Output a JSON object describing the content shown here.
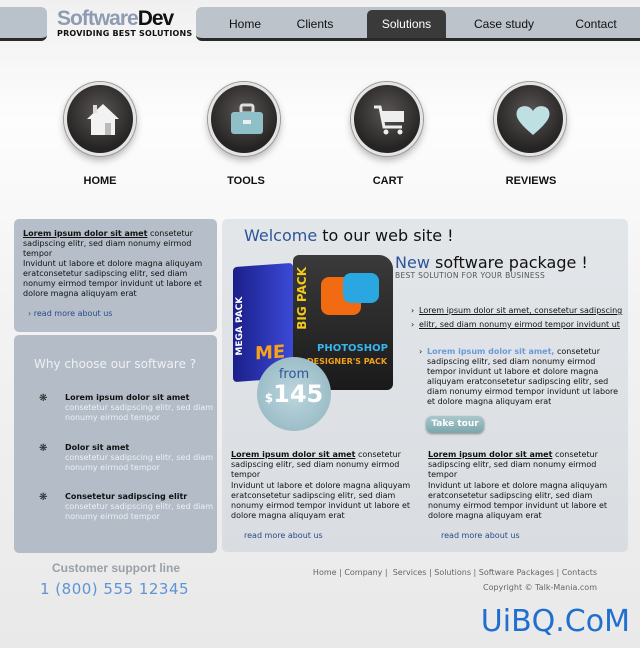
{
  "logo": {
    "brand_light": "Software",
    "brand_dark": "Dev",
    "tagline": "PROVIDING BEST SOLUTIONS"
  },
  "nav": [
    {
      "label": "Home"
    },
    {
      "label": "Clients"
    },
    {
      "label": "Solutions",
      "active": true
    },
    {
      "label": "Case study"
    },
    {
      "label": "Contact"
    }
  ],
  "icons": [
    {
      "label": "HOME",
      "icon": "house-icon"
    },
    {
      "label": "TOOLS",
      "icon": "toolbox-icon"
    },
    {
      "label": "CART",
      "icon": "cart-icon"
    },
    {
      "label": "REVIEWS",
      "icon": "heart-icon"
    }
  ],
  "about": {
    "bold": "Lorem ipsum dolor sit amet",
    "text1": " consetetur sadipscing elitr, sed diam nonumy eirmod tempor",
    "text2": "Invidunt ut labore et dolore magna aliquyam eratconsetetur sadipscing elitr, sed diam nonumy eirmod tempor invidunt ut labore et dolore magna aliquyam erat",
    "link": "read more about us"
  },
  "why": {
    "title": "Why choose our software ?",
    "items": [
      {
        "title": "Lorem ipsum dolor sit amet",
        "text": "consetetur sadipscing elitr, sed diam nonumy eirmod tempor"
      },
      {
        "title": "Dolor sit amet",
        "text": "consetetur sadipscing elitr, sed diam nonumy eirmod tempor"
      },
      {
        "title": "Consetetur sadipscing elitr",
        "text": "consetetur sadipscing elitr, sed diam nonumy eirmod tempor"
      }
    ]
  },
  "main": {
    "welcome_hl": "Welcome",
    "welcome_rest": " to our web site !",
    "new_hl": "New",
    "new_rest": " software package !",
    "subtitle": "BEST SOLUTION FOR YOUR BUSINESS",
    "price_from": "from",
    "price_currency": "$",
    "price": "145",
    "box_labels": {
      "mega": "MEGA PACK",
      "big": "BIG PACK",
      "ps": "PHOTOSHOP",
      "dp": "DESIGNER'S PACK"
    },
    "links": [
      "Lorem ipsum dolor sit amet, consetetur sadipscing",
      "elitr, sed diam nonumy eirmod tempor invidunt ut"
    ],
    "para_hl": "Lorem ipsum dolor sit amet,",
    "para_text": " consetetur sadipscing elitr, sed diam nonumy eirmod tempor invidunt ut labore et dolore magna aliquyam eratconsetetur sadipscing elitr, sed diam nonumy eirmod tempor invidunt ut labore et dolore magna aliquyam erat",
    "tour": "Take tour",
    "cols": [
      {
        "bold": "Lorem ipsum dolor sit amet",
        "text1": " consetetur sadipscing elitr, sed diam nonumy eirmod tempor",
        "text2": "Invidunt ut labore et dolore magna aliquyam eratconsetetur sadipscing elitr, sed diam nonumy eirmod tempor invidunt ut labore et dolore magna aliquyam erat",
        "link": "read more about us"
      },
      {
        "bold": "Lorem ipsum dolor sit amet",
        "text1": " consetetur sadipscing elitr, sed diam nonumy eirmod tempor",
        "text2": "Invidunt ut labore et dolore magna aliquyam eratconsetetur sadipscing elitr, sed diam nonumy eirmod tempor invidunt ut labore et dolore magna aliquyam erat",
        "link": "read more about us"
      }
    ]
  },
  "footer": {
    "support": "Customer support line",
    "phone": "1 (800) 555 12345",
    "links": [
      "Home",
      "Company",
      "Services",
      "Solutions",
      "Software Packages",
      "Contacts"
    ],
    "copyright": "Copyright © Talk-Mania.com",
    "watermark": "UiBQ.CoM"
  },
  "colors": {
    "accent_blue": "#2d5599",
    "phone_blue": "#5d94d6",
    "panel": "#b6bec9",
    "nav_active": "#3a3a3a"
  }
}
